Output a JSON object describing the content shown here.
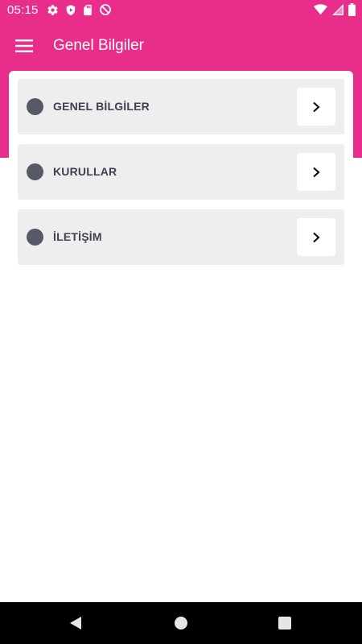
{
  "status_bar": {
    "time": "05:15",
    "left_icons": [
      "settings-icon",
      "shield-play-icon",
      "sd-card-icon",
      "do-not-disturb-icon"
    ],
    "right_icons": [
      "wifi-icon",
      "signal-icon",
      "battery-icon"
    ]
  },
  "app_bar": {
    "title": "Genel Bilgiler",
    "menu_icon": "hamburger-menu-icon"
  },
  "menu": {
    "items": [
      {
        "label": "GENEL BİLGİLER",
        "icon": "chevron-right-icon"
      },
      {
        "label": "KURULLAR",
        "icon": "chevron-right-icon"
      },
      {
        "label": "İLETİŞİM",
        "icon": "chevron-right-icon"
      }
    ]
  },
  "nav_bar": {
    "buttons": [
      "back-icon",
      "home-icon",
      "recents-icon"
    ]
  },
  "colors": {
    "brand": "#e82d8a",
    "item_background": "#eeeeee",
    "dot": "#575a66",
    "label": "#3e4150"
  }
}
